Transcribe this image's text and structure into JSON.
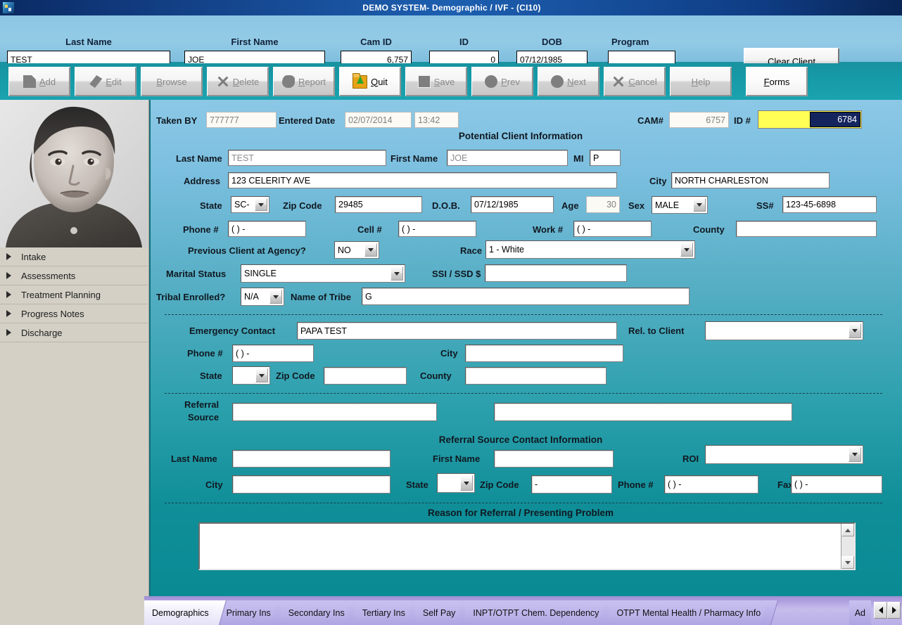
{
  "window": {
    "title": "DEMO SYSTEM- Demographic / IVF - (CI10)",
    "icon": "app-icon"
  },
  "client_bar": {
    "fields": [
      {
        "label": "Last Name",
        "value": "TEST",
        "align": "left"
      },
      {
        "label": "First Name",
        "value": "JOE",
        "align": "left"
      },
      {
        "label": "Cam ID",
        "value": "6,757",
        "align": "right"
      },
      {
        "label": "ID",
        "value": "0",
        "align": "right"
      },
      {
        "label": "DOB",
        "value": "07/12/1985",
        "align": "left"
      },
      {
        "label": "Program",
        "value": "",
        "align": "left"
      }
    ],
    "clear_button": "Clear Client"
  },
  "toolbar": {
    "buttons": [
      {
        "label": "Add",
        "icon": "page-icon",
        "enabled": false
      },
      {
        "label": "Edit",
        "icon": "pencil-icon",
        "enabled": false
      },
      {
        "label": "Browse",
        "icon": "none",
        "enabled": false
      },
      {
        "label": "Delete",
        "icon": "x-icon",
        "enabled": false
      },
      {
        "label": "Report",
        "icon": "report-icon",
        "enabled": false
      },
      {
        "label": "Quit",
        "icon": "quit-icon",
        "enabled": true
      },
      {
        "label": "Save",
        "icon": "square-icon",
        "enabled": false
      },
      {
        "label": "Prev",
        "icon": "circle-icon",
        "enabled": false
      },
      {
        "label": "Next",
        "icon": "circle-icon",
        "enabled": false
      },
      {
        "label": "Cancel",
        "icon": "x-icon",
        "enabled": false
      },
      {
        "label": "Help",
        "icon": "none",
        "enabled": false
      },
      {
        "label": "Forms",
        "icon": "none",
        "enabled": true
      }
    ]
  },
  "sidebar": {
    "photo_alt": "client-photo",
    "items": [
      {
        "label": "Intake"
      },
      {
        "label": "Assessments"
      },
      {
        "label": "Treatment Planning"
      },
      {
        "label": "Progress Notes"
      },
      {
        "label": "Discharge"
      }
    ]
  },
  "form": {
    "taken_by_label": "Taken BY",
    "taken_by_value": "777777",
    "entered_date_label": "Entered Date",
    "entered_date_value": "02/07/2014",
    "entered_time_value": "13:42",
    "cam_label": "CAM#",
    "cam_value": "6757",
    "id_label": "ID #",
    "id_value": "6784",
    "section_title": "Potential Client Information",
    "last_name_label": "Last Name",
    "last_name_value": "TEST",
    "first_name_label": "First Name",
    "first_name_value": "JOE",
    "mi_label": "MI",
    "mi_value": "P",
    "address_label": "Address",
    "address_value": "123 CELERITY AVE",
    "city_label": "City",
    "city_value": "NORTH CHARLESTON",
    "state_label": "State",
    "state_value": "SC-",
    "zip_label": "Zip Code",
    "zip_value": "29485",
    "dob_label": "D.O.B.",
    "dob_value": "07/12/1985",
    "age_label": "Age",
    "age_value": "30",
    "sex_label": "Sex",
    "sex_value": "MALE",
    "ss_label": "SS#",
    "ss_value": "123-45-6898",
    "phone_label": "Phone #",
    "phone_value": "(  )   -   ",
    "cell_label": "Cell #",
    "cell_value": "(  )   -   ",
    "work_label": "Work #",
    "work_value": "(  )   -   ",
    "county_label": "County",
    "county_value": "",
    "previous_client_label": "Previous Client at Agency?",
    "previous_client_value": "NO",
    "race_label": "Race",
    "race_value": "1 - White",
    "marital_label": "Marital Status",
    "marital_value": "SINGLE",
    "ssi_label": "SSI / SSD $",
    "ssi_value": "",
    "tribal_label": "Tribal Enrolled?",
    "tribal_value": "N/A",
    "tribe_name_label": "Name of Tribe",
    "tribe_name_value": "G"
  },
  "emergency": {
    "contact_label": "Emergency Contact",
    "contact_value": "PAPA TEST",
    "rel_label": "Rel. to Client",
    "rel_value": "",
    "phone_label": "Phone #",
    "phone_value": "(  )   -   ",
    "city_label": "City",
    "city_value": "",
    "state_label": "State",
    "state_value": "",
    "zip_label": "Zip Code",
    "zip_value": "",
    "county_label": "County",
    "county_value": ""
  },
  "referral": {
    "source_label_line1": "Referral",
    "source_label_line2": "Source",
    "source_value_1": "",
    "source_value_2": "",
    "contact_title": "Referral Source Contact Information",
    "last_name_label": "Last Name",
    "last_name_value": "",
    "first_name_label": "First Name",
    "first_name_value": "",
    "roi_label": "ROI",
    "roi_value": "",
    "city_label": "City",
    "city_value": "",
    "state_label": "State",
    "state_value": "",
    "zip_label": "Zip Code",
    "zip_value": "    -    ",
    "phone_label": "Phone #",
    "phone_value": "(  )   -   ",
    "fax_label": "Fax #",
    "fax_value": "(  )   -   "
  },
  "reason": {
    "title": "Reason for Referral / Presenting Problem",
    "value": ""
  },
  "tabs": {
    "items": [
      {
        "label": "Demographics",
        "active": true
      },
      {
        "label": "Primary Ins",
        "active": false
      },
      {
        "label": "Secondary Ins",
        "active": false
      },
      {
        "label": "Tertiary Ins",
        "active": false
      },
      {
        "label": "Self Pay",
        "active": false
      },
      {
        "label": "INPT/OTPT Chem. Dependency",
        "active": false
      },
      {
        "label": "OTPT Mental Health / Pharmacy Info",
        "active": false
      }
    ],
    "partial_label": "Ad",
    "scroll_left": "scroll-left",
    "scroll_right": "scroll-right"
  },
  "colors": {
    "titlebar": "#1d5fb0",
    "toolbar": "#169aa7",
    "form_top": "#8cc8e6",
    "form_bottom": "#0a8b94",
    "id_highlight": "#ffff55",
    "id_selection": "#14255e",
    "tab_strip": "#b0a2e0"
  }
}
